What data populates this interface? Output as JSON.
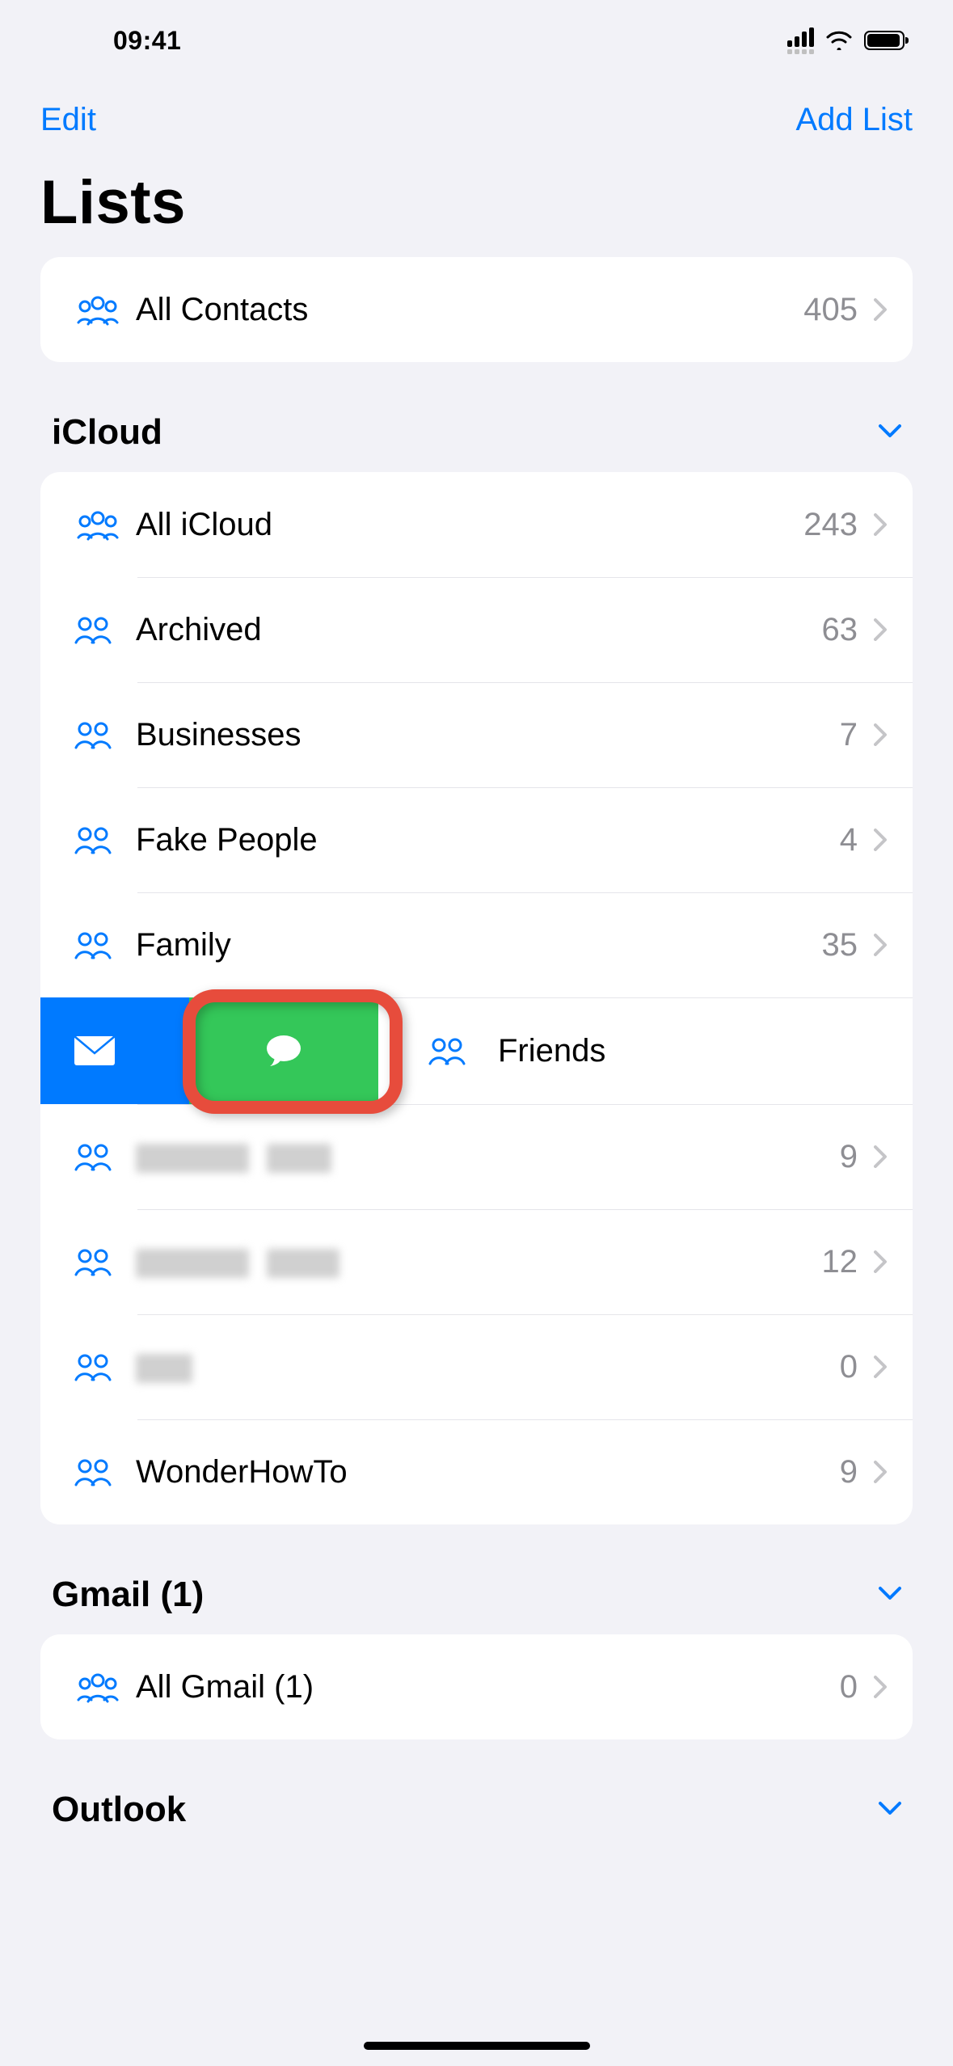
{
  "status": {
    "time": "09:41"
  },
  "nav": {
    "edit": "Edit",
    "add_list": "Add List"
  },
  "title": "Lists",
  "top": {
    "label": "All Contacts",
    "count": "405"
  },
  "sections": {
    "icloud": {
      "title": "iCloud",
      "items": [
        {
          "label": "All iCloud",
          "count": "243",
          "icon": "group3"
        },
        {
          "label": "Archived",
          "count": "63",
          "icon": "group2"
        },
        {
          "label": "Businesses",
          "count": "7",
          "icon": "group2"
        },
        {
          "label": "Fake People",
          "count": "4",
          "icon": "group2"
        },
        {
          "label": "Family",
          "count": "35",
          "icon": "group2"
        },
        {
          "label": "Friends",
          "count": "",
          "icon": "group2",
          "swiped": true
        },
        {
          "label": "",
          "count": "9",
          "icon": "group2",
          "blurred": true
        },
        {
          "label": "",
          "count": "12",
          "icon": "group2",
          "blurred": true
        },
        {
          "label": "",
          "count": "0",
          "icon": "group2",
          "blurred": true
        },
        {
          "label": "WonderHowTo",
          "count": "9",
          "icon": "group2"
        }
      ]
    },
    "gmail": {
      "title": "Gmail (1)",
      "items": [
        {
          "label": "All Gmail (1)",
          "count": "0",
          "icon": "group3"
        }
      ]
    },
    "outlook": {
      "title": "Outlook"
    }
  }
}
